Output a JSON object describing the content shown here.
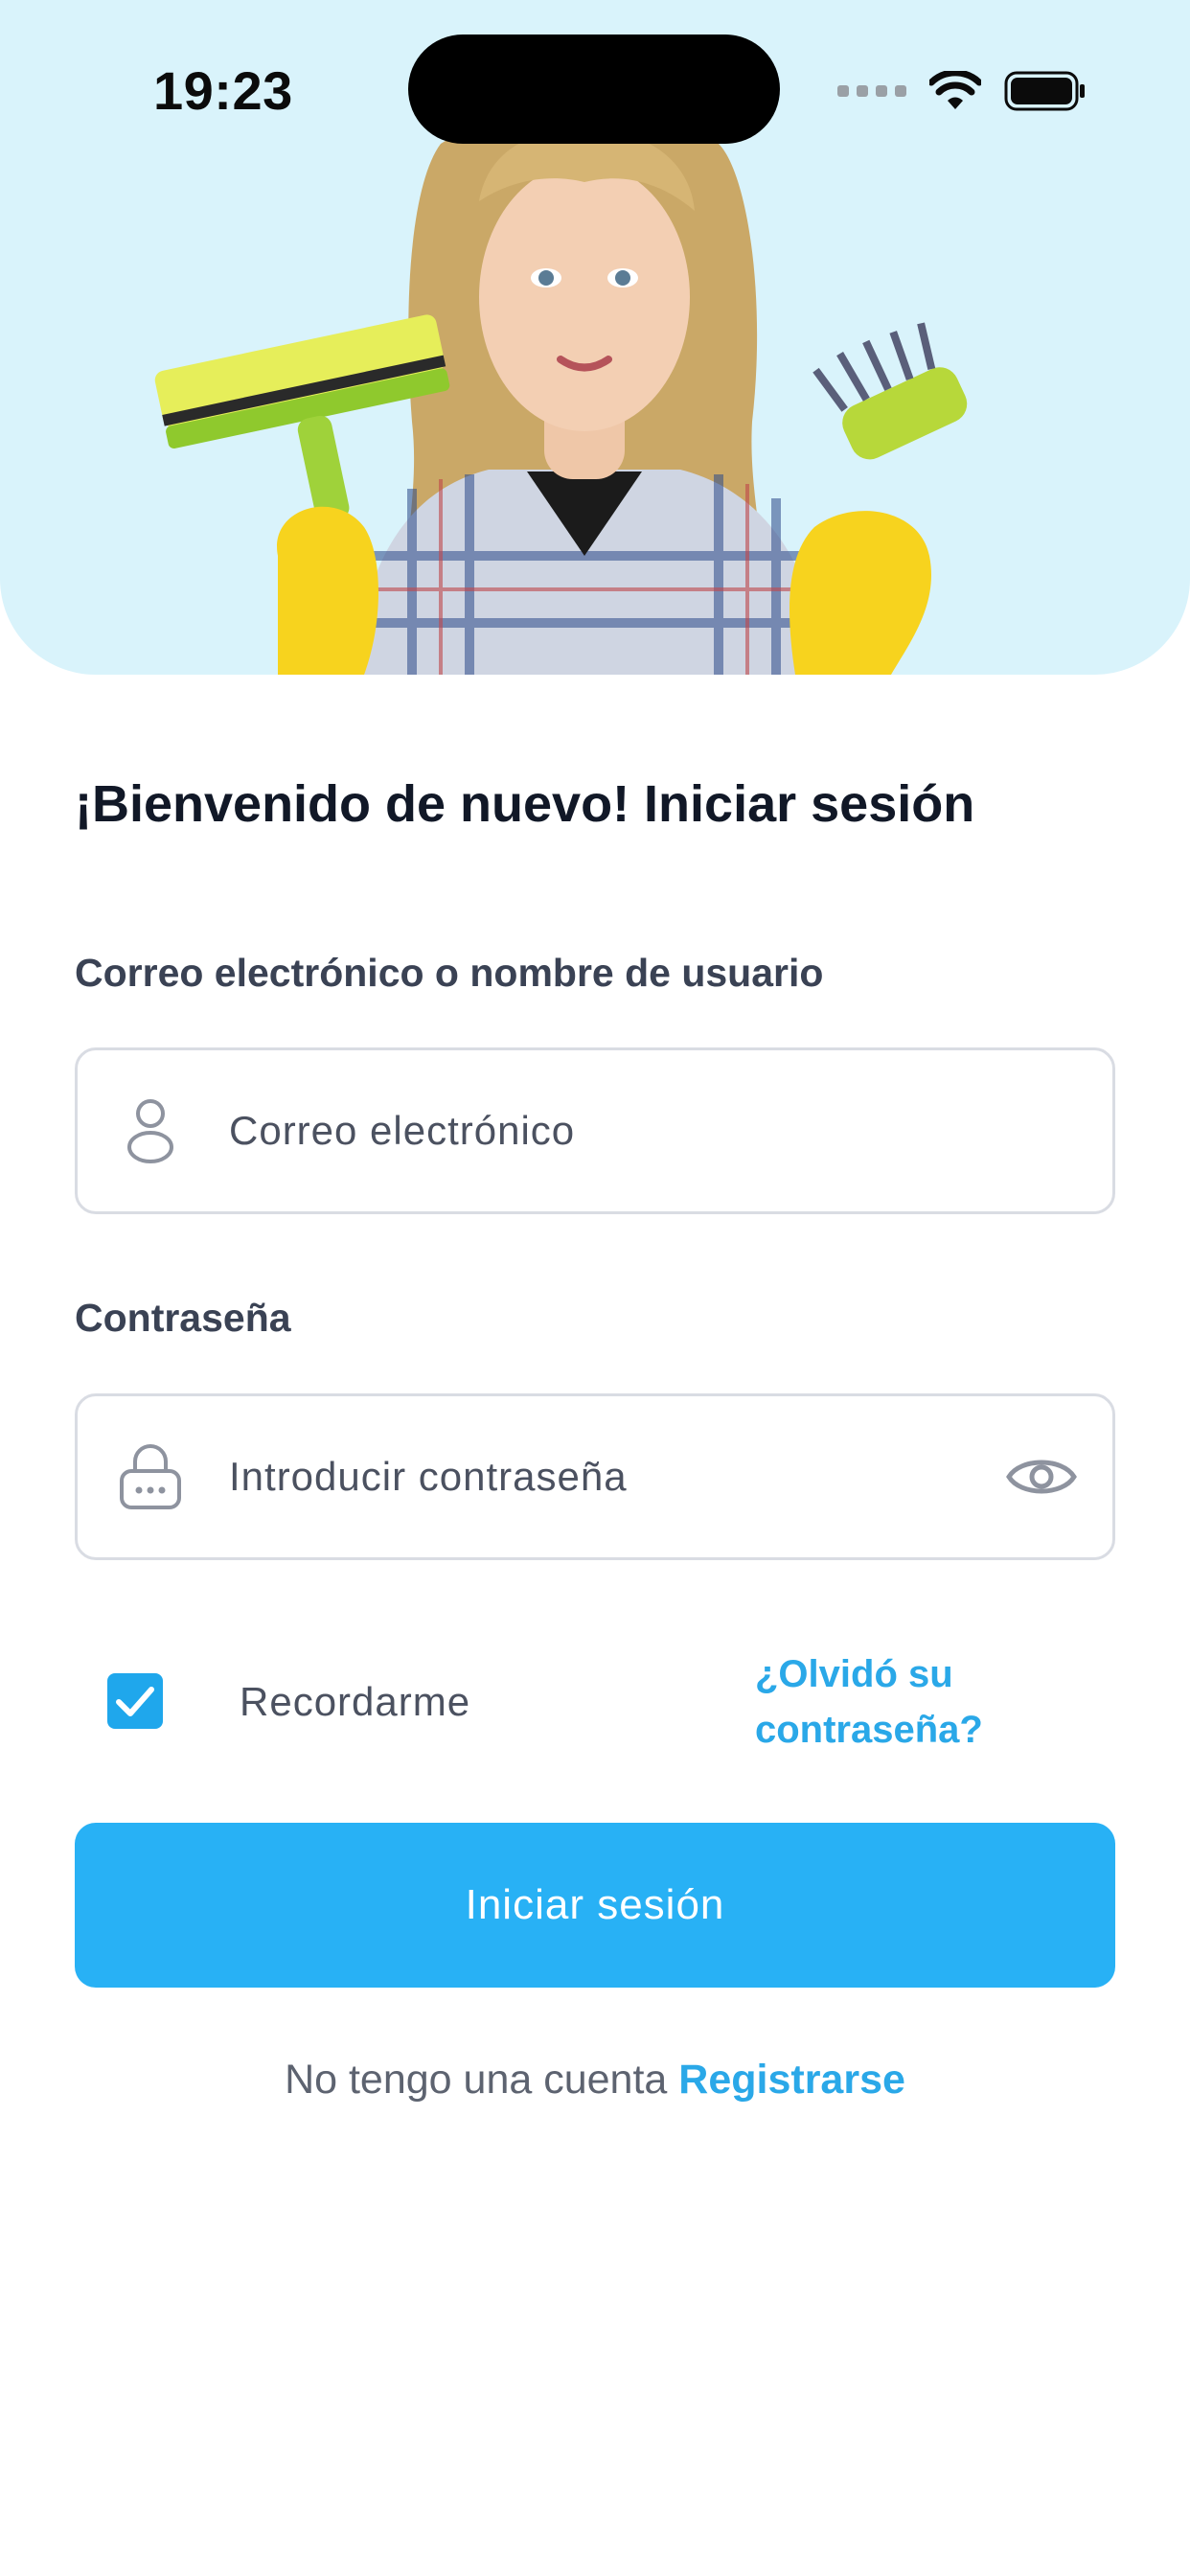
{
  "status_bar": {
    "time": "19:23"
  },
  "header": {
    "hero_image": "cleaning-woman-photo",
    "background_color": "#d9f3fb"
  },
  "form": {
    "title": "¡Bienvenido de nuevo! Iniciar sesión",
    "email_label": "Correo electrónico o nombre de usuario",
    "email_placeholder": "Correo electrónico",
    "password_label": "Contraseña",
    "password_placeholder": "Introducir contraseña",
    "remember_label": "Recordarme",
    "remember_checked": true,
    "forgot_line1": "¿Olvidó su",
    "forgot_line2": "contraseña?",
    "login_button": "Iniciar sesión",
    "no_account_text": "No tengo una cuenta",
    "register_link": "Registrarse"
  },
  "colors": {
    "accent": "#28b1f5",
    "link": "#2aa8e8",
    "title": "#111827",
    "border": "#d9dce3"
  },
  "icons": [
    "wifi-icon",
    "battery-icon",
    "user-icon",
    "lock-icon",
    "eye-icon",
    "checkmark-icon"
  ]
}
